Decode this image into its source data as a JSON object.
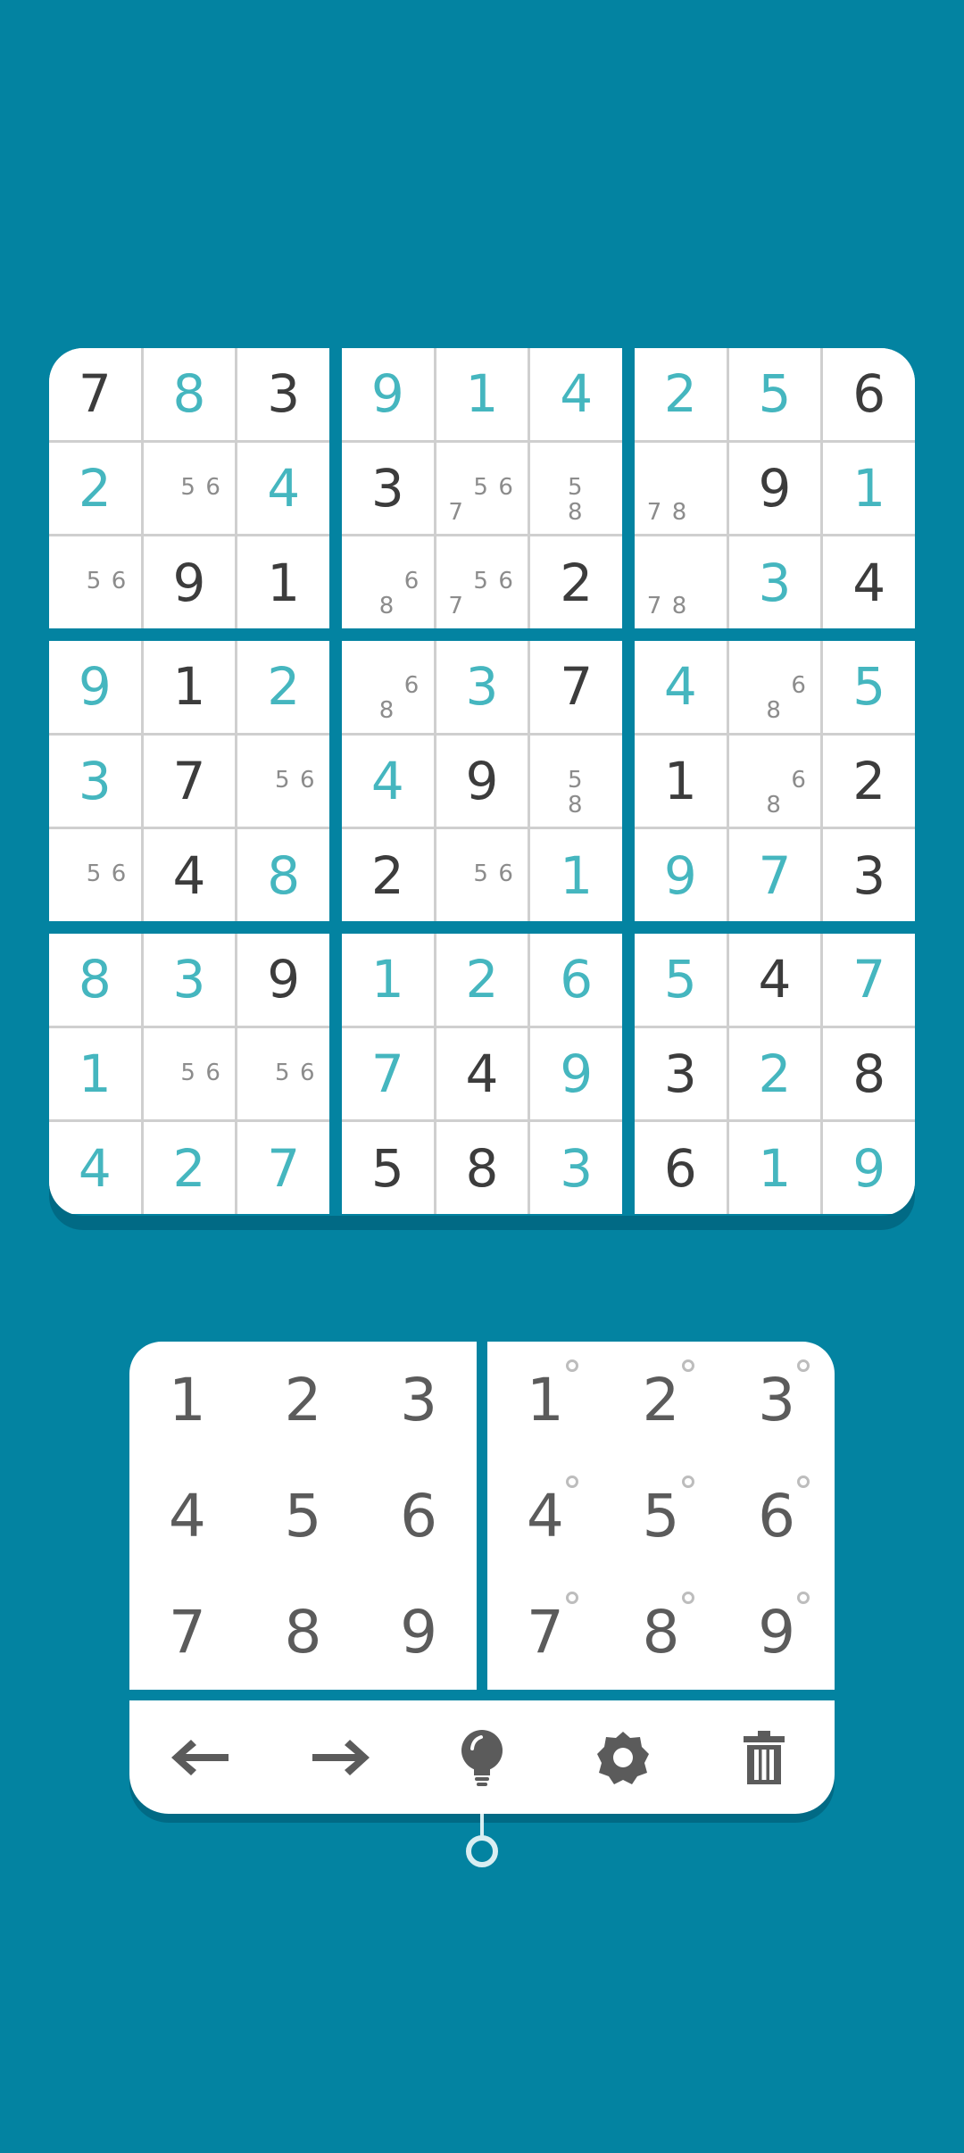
{
  "sudoku": {
    "rows": [
      [
        {
          "v": "7",
          "k": "given"
        },
        {
          "v": "8",
          "k": "user"
        },
        {
          "v": "3",
          "k": "given"
        },
        {
          "v": "9",
          "k": "user"
        },
        {
          "v": "1",
          "k": "user"
        },
        {
          "v": "4",
          "k": "user"
        },
        {
          "v": "2",
          "k": "user"
        },
        {
          "v": "5",
          "k": "user"
        },
        {
          "v": "6",
          "k": "given"
        }
      ],
      [
        {
          "v": "2",
          "k": "user"
        },
        {
          "n": [
            "5",
            "6"
          ]
        },
        {
          "v": "4",
          "k": "user"
        },
        {
          "v": "3",
          "k": "given"
        },
        {
          "n": [
            "5",
            "6",
            "7"
          ]
        },
        {
          "n": [
            "5",
            "8"
          ]
        },
        {
          "n": [
            "7",
            "8"
          ]
        },
        {
          "v": "9",
          "k": "given"
        },
        {
          "v": "1",
          "k": "user"
        }
      ],
      [
        {
          "n": [
            "5",
            "6"
          ]
        },
        {
          "v": "9",
          "k": "given"
        },
        {
          "v": "1",
          "k": "given"
        },
        {
          "n": [
            "6",
            "8"
          ]
        },
        {
          "n": [
            "5",
            "6",
            "7"
          ]
        },
        {
          "v": "2",
          "k": "given"
        },
        {
          "n": [
            "7",
            "8"
          ]
        },
        {
          "v": "3",
          "k": "user"
        },
        {
          "v": "4",
          "k": "given"
        }
      ],
      [
        {
          "v": "9",
          "k": "user"
        },
        {
          "v": "1",
          "k": "given"
        },
        {
          "v": "2",
          "k": "user"
        },
        {
          "n": [
            "6",
            "8"
          ]
        },
        {
          "v": "3",
          "k": "user"
        },
        {
          "v": "7",
          "k": "given"
        },
        {
          "v": "4",
          "k": "user"
        },
        {
          "n": [
            "6",
            "8"
          ]
        },
        {
          "v": "5",
          "k": "user"
        }
      ],
      [
        {
          "v": "3",
          "k": "user"
        },
        {
          "v": "7",
          "k": "given"
        },
        {
          "n": [
            "5",
            "6"
          ]
        },
        {
          "v": "4",
          "k": "user"
        },
        {
          "v": "9",
          "k": "given"
        },
        {
          "n": [
            "5",
            "8"
          ]
        },
        {
          "v": "1",
          "k": "given"
        },
        {
          "n": [
            "6",
            "8"
          ]
        },
        {
          "v": "2",
          "k": "given"
        }
      ],
      [
        {
          "n": [
            "5",
            "6"
          ]
        },
        {
          "v": "4",
          "k": "given"
        },
        {
          "v": "8",
          "k": "user"
        },
        {
          "v": "2",
          "k": "given"
        },
        {
          "n": [
            "5",
            "6"
          ]
        },
        {
          "v": "1",
          "k": "user"
        },
        {
          "v": "9",
          "k": "user"
        },
        {
          "v": "7",
          "k": "user"
        },
        {
          "v": "3",
          "k": "given"
        }
      ],
      [
        {
          "v": "8",
          "k": "user"
        },
        {
          "v": "3",
          "k": "user"
        },
        {
          "v": "9",
          "k": "given"
        },
        {
          "v": "1",
          "k": "user"
        },
        {
          "v": "2",
          "k": "user"
        },
        {
          "v": "6",
          "k": "user"
        },
        {
          "v": "5",
          "k": "user"
        },
        {
          "v": "4",
          "k": "given"
        },
        {
          "v": "7",
          "k": "user"
        }
      ],
      [
        {
          "v": "1",
          "k": "user"
        },
        {
          "n": [
            "5",
            "6"
          ]
        },
        {
          "n": [
            "5",
            "6"
          ]
        },
        {
          "v": "7",
          "k": "user"
        },
        {
          "v": "4",
          "k": "given"
        },
        {
          "v": "9",
          "k": "user"
        },
        {
          "v": "3",
          "k": "given"
        },
        {
          "v": "2",
          "k": "user"
        },
        {
          "v": "8",
          "k": "given"
        }
      ],
      [
        {
          "v": "4",
          "k": "user"
        },
        {
          "v": "2",
          "k": "user"
        },
        {
          "v": "7",
          "k": "user"
        },
        {
          "v": "5",
          "k": "given"
        },
        {
          "v": "8",
          "k": "given"
        },
        {
          "v": "3",
          "k": "user"
        },
        {
          "v": "6",
          "k": "given"
        },
        {
          "v": "1",
          "k": "user"
        },
        {
          "v": "9",
          "k": "user"
        }
      ]
    ]
  },
  "number_pad": {
    "digits": [
      "1",
      "2",
      "3",
      "4",
      "5",
      "6",
      "7",
      "8",
      "9"
    ]
  },
  "notes_pad": {
    "digits": [
      "1",
      "2",
      "3",
      "4",
      "5",
      "6",
      "7",
      "8",
      "9"
    ]
  },
  "toolbar": {
    "tools": [
      "undo-icon",
      "redo-icon",
      "hint-bulb-icon",
      "settings-gear-icon",
      "trash-icon"
    ]
  },
  "colors": {
    "background": "#0383a1",
    "given_digit": "#3c3c3c",
    "user_digit": "#45b6bf",
    "note_digit": "#8c8c8c",
    "key_digit": "#5b5b5b"
  }
}
